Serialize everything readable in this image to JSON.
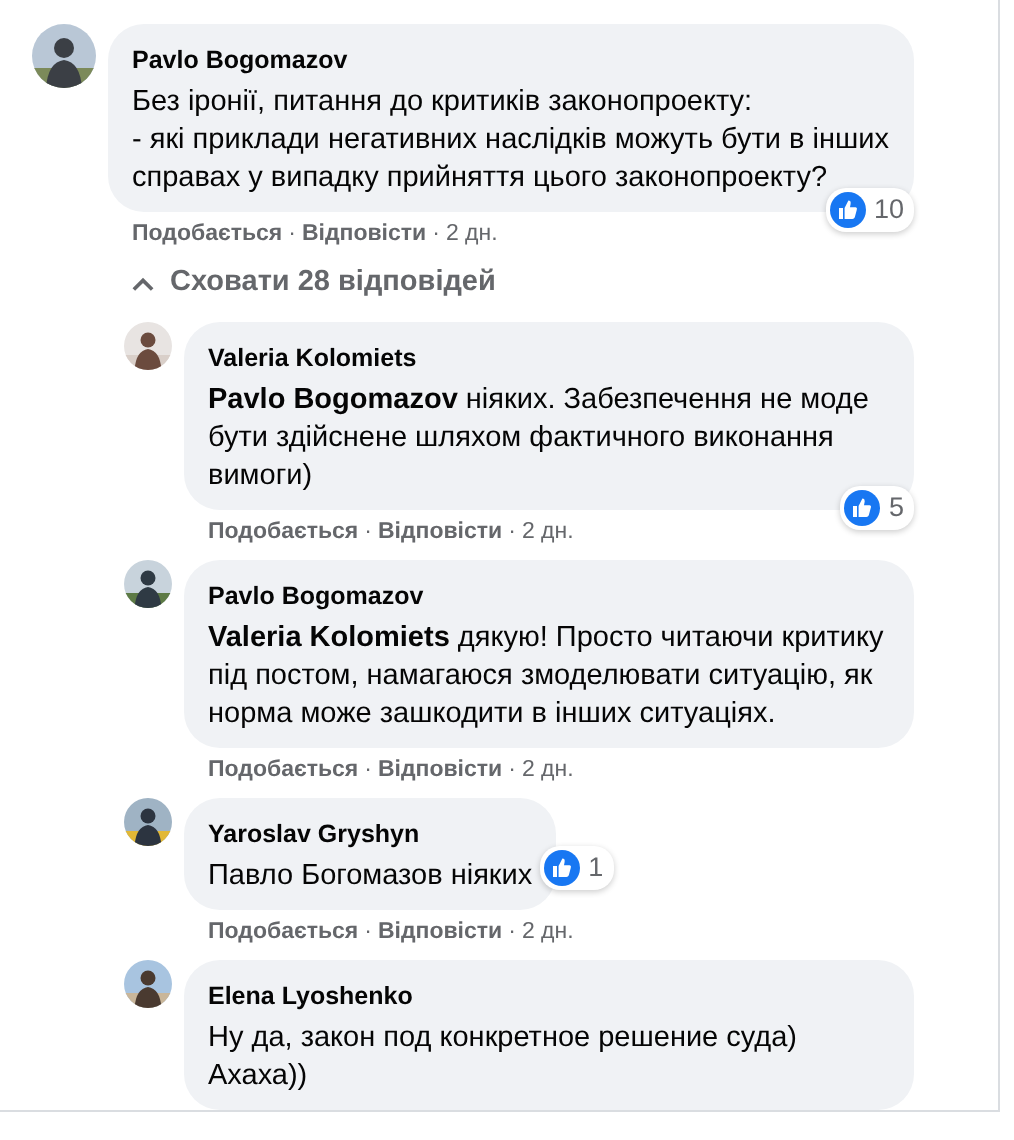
{
  "comments": [
    {
      "author": "Pavlo Bogomazov",
      "text": "Без іронії, питання до критиків законопроекту:\n- які приклади негативних наслідків можуть бути в інших справах у випадку прийняття цього законопроекту?",
      "reactions": "10",
      "actions": {
        "like": "Подобається",
        "reply": "Відповісти",
        "time": "2 дн."
      }
    }
  ],
  "separator": "·",
  "replies_toggle": {
    "label": "Сховати 28 відповідей",
    "expanded": true
  },
  "replies": [
    {
      "author": "Valeria Kolomiets",
      "text": "**Pavlo Bogomazov** ніяких. Забезпечення не моде бути здійснене шляхом фактичного виконання вимоги)",
      "reactions": "5",
      "actions": {
        "like": "Подобається",
        "reply": "Відповісти",
        "time": "2 дн."
      }
    },
    {
      "author": "Pavlo Bogomazov",
      "text": "**Valeria Kolomiets** дякую! Просто читаючи критику під постом, намагаюся змоделювати ситуацію, як норма може зашкодити в інших ситуаціях.",
      "actions": {
        "like": "Подобається",
        "reply": "Відповісти",
        "time": "2 дн."
      }
    },
    {
      "author": "Yaroslav Gryshyn",
      "text": "Павло Богомазов ніяких",
      "reactions": "1",
      "actions": {
        "like": "Подобається",
        "reply": "Відповісти",
        "time": "2 дн."
      }
    },
    {
      "author": "Elena Lyoshenko",
      "text": "Ну да, закон под конкретное решение суда) Ахаха))"
    }
  ]
}
